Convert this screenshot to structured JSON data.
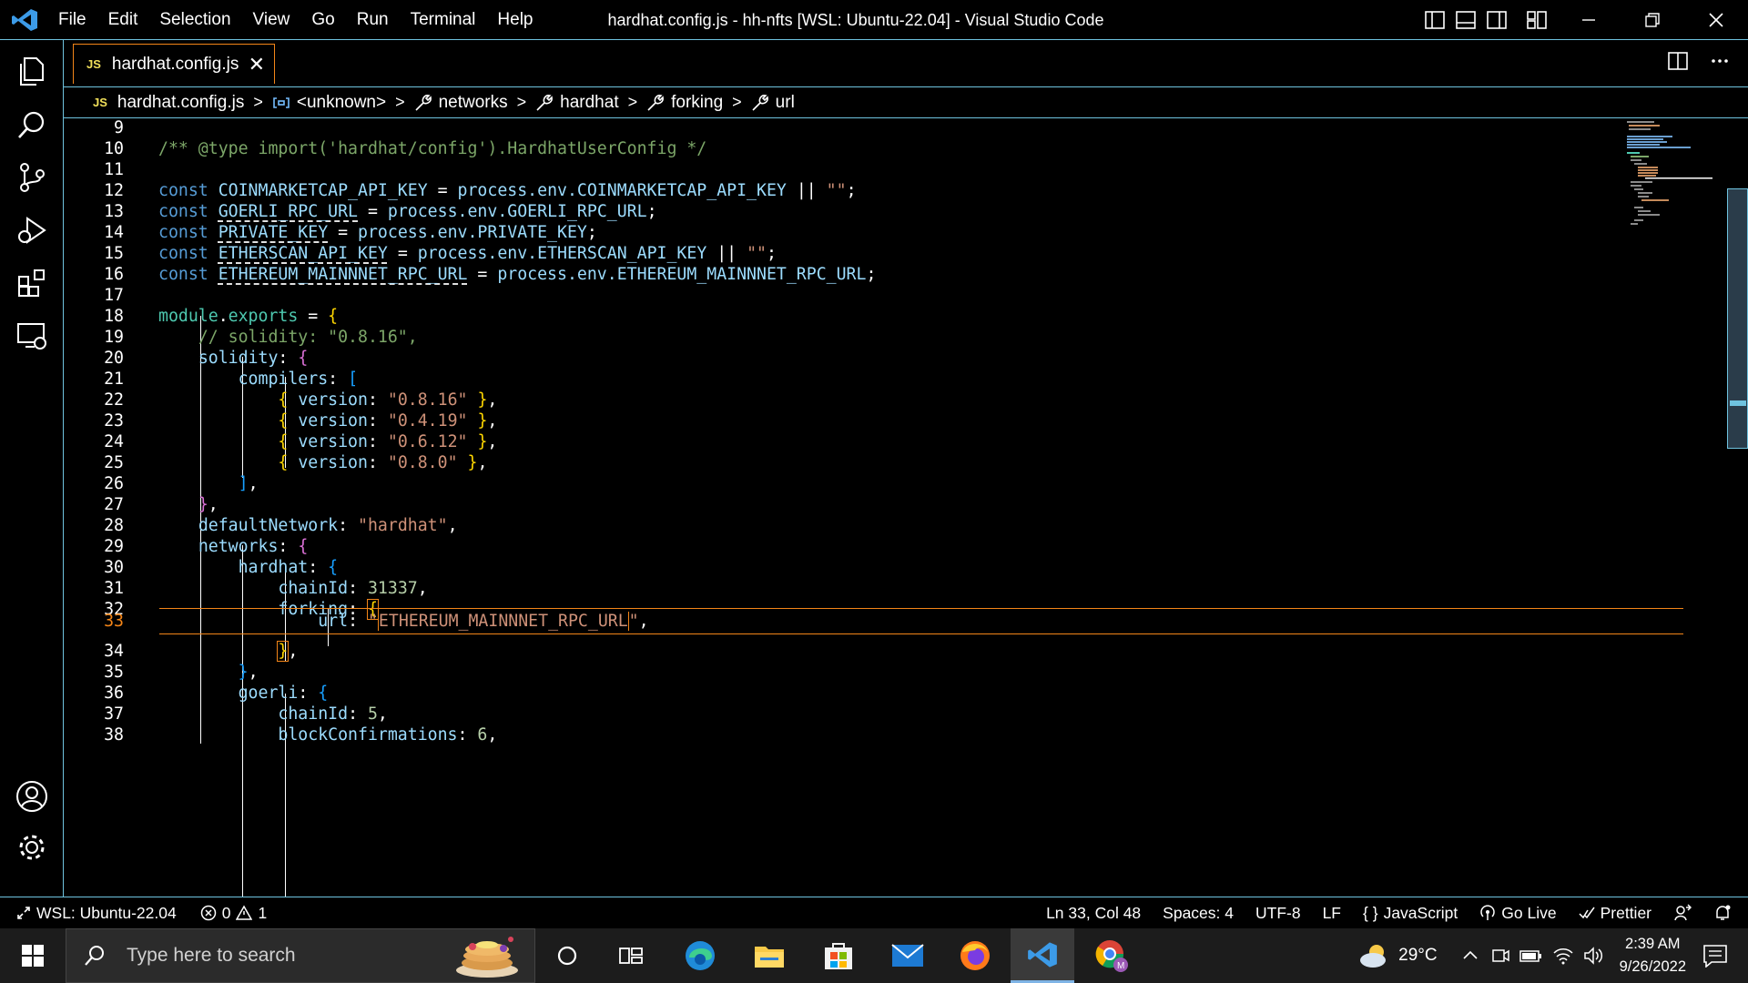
{
  "titlebar": {
    "menu": [
      "File",
      "Edit",
      "Selection",
      "View",
      "Go",
      "Run",
      "Terminal",
      "Help"
    ],
    "title": "hardhat.config.js - hh-nfts [WSL: Ubuntu-22.04] - Visual Studio Code"
  },
  "tab": {
    "badge": "JS",
    "title": "hardhat.config.js",
    "close": "✕"
  },
  "breadcrumb": {
    "file": "hardhat.config.js",
    "items": [
      "<unknown>",
      "networks",
      "hardhat",
      "forking",
      "url"
    ],
    "sep": ">"
  },
  "editor": {
    "current_line": 33,
    "lines": [
      {
        "n": "9"
      },
      {
        "n": "10"
      },
      {
        "n": "11"
      },
      {
        "n": "12"
      },
      {
        "n": "13"
      },
      {
        "n": "14"
      },
      {
        "n": "15"
      },
      {
        "n": "16"
      },
      {
        "n": "17"
      },
      {
        "n": "18"
      },
      {
        "n": "19"
      },
      {
        "n": "20"
      },
      {
        "n": "21"
      },
      {
        "n": "22"
      },
      {
        "n": "23"
      },
      {
        "n": "24"
      },
      {
        "n": "25"
      },
      {
        "n": "26"
      },
      {
        "n": "27"
      },
      {
        "n": "28"
      },
      {
        "n": "29"
      },
      {
        "n": "30"
      },
      {
        "n": "31"
      },
      {
        "n": "32"
      },
      {
        "n": "33"
      },
      {
        "n": "34"
      },
      {
        "n": "35"
      },
      {
        "n": "36"
      },
      {
        "n": "37"
      },
      {
        "n": "38"
      }
    ],
    "code": {
      "l10": "/** @type import('hardhat/config').HardhatUserConfig */",
      "k_const": "const",
      "l12_name": "COINMARKETCAP_API_KEY",
      "l12_rhs": "process.env.COINMARKETCAP_API_KEY",
      "l13_name": "GOERLI_RPC_URL",
      "l13_rhs": "process.env.GOERLI_RPC_URL",
      "l14_name": "PRIVATE_KEY",
      "l14_rhs": "process.env.PRIVATE_KEY",
      "l15_name": "ETHERSCAN_API_KEY",
      "l15_rhs": "process.env.ETHERSCAN_API_KEY",
      "l16_name": "ETHEREUM_MAINNNET_RPC_URL",
      "l16_rhs": "process.env.ETHEREUM_MAINNNET_RPC_URL",
      "l18_obj": "module",
      "l18_prop": "exports",
      "l19": "// solidity: \"0.8.16\",",
      "solidity": "solidity",
      "compilers": "compilers",
      "version": "version",
      "versions": [
        "\"0.8.16\"",
        "\"0.4.19\"",
        "\"0.6.12\"",
        "\"0.8.0\""
      ],
      "defaultNetwork": "defaultNetwork",
      "defaultNetwork_val": "\"hardhat\"",
      "networks": "networks",
      "hardhat": "hardhat",
      "chainId": "chainId",
      "chainId_hardhat": "31337",
      "forking": "forking",
      "url": "url",
      "url_val": "ETHEREUM_MAINNNET_RPC_URL",
      "goerli": "goerli",
      "chainId_goerli": "5",
      "blockConfirmations": "blockConfirmations",
      "blockConfirmations_val": "6",
      "or": "||",
      "empty": "\"\"",
      "eq": "="
    }
  },
  "statusbar": {
    "remote": "WSL: Ubuntu-22.04",
    "errors": "0",
    "warnings": "1",
    "position": "Ln 33, Col 48",
    "spaces": "Spaces: 4",
    "encoding": "UTF-8",
    "eol": "LF",
    "language": "JavaScript",
    "golive": "Go Live",
    "prettier": "Prettier"
  },
  "taskbar": {
    "search_placeholder": "Type here to search",
    "apps": [
      "cortana-icon",
      "task-view-icon",
      "edge-icon",
      "file-explorer-icon",
      "store-icon",
      "mail-icon",
      "firefox-icon",
      "vscode-icon",
      "chrome-icon"
    ],
    "temperature": "29°C",
    "time": "2:39 AM",
    "date": "9/26/2022"
  },
  "colors": {
    "accent": "#6fc3df",
    "active_border": "#f38518"
  }
}
